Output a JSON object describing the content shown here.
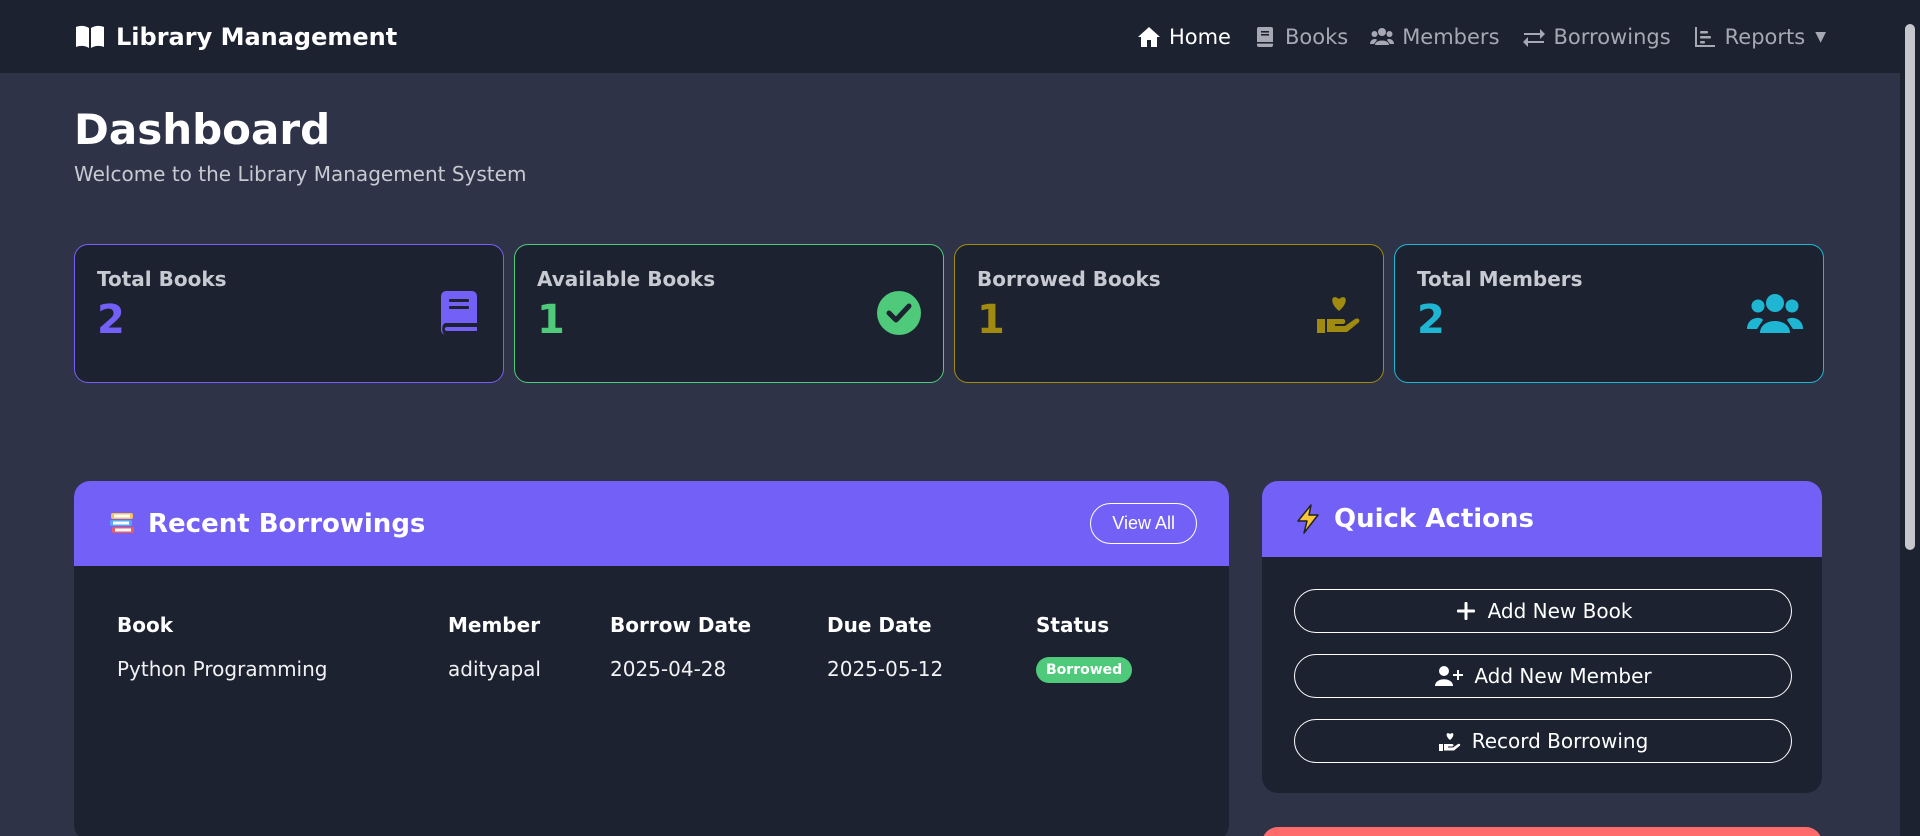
{
  "navbar": {
    "brand": "Library Management",
    "items": [
      {
        "label": "Home",
        "icon": "home-icon",
        "active": true
      },
      {
        "label": "Books",
        "icon": "book-icon",
        "active": false
      },
      {
        "label": "Members",
        "icon": "users-icon",
        "active": false
      },
      {
        "label": "Borrowings",
        "icon": "exchange-icon",
        "active": false
      },
      {
        "label": "Reports",
        "icon": "chart-icon",
        "active": false
      }
    ]
  },
  "header": {
    "title": "Dashboard",
    "subtitle": "Welcome to the Library Management System"
  },
  "stats": [
    {
      "label": "Total Books",
      "value": "2",
      "color": "#7360f6",
      "icon": "book-icon"
    },
    {
      "label": "Available Books",
      "value": "1",
      "color": "#4fc97a",
      "icon": "check-circle-icon"
    },
    {
      "label": "Borrowed Books",
      "value": "1",
      "color": "#a08b10",
      "icon": "hand-heart-icon"
    },
    {
      "label": "Total Members",
      "value": "2",
      "color": "#1fb6d4",
      "icon": "users-icon"
    }
  ],
  "recent": {
    "title": "Recent Borrowings",
    "view_all": "View All",
    "columns": [
      "Book",
      "Member",
      "Borrow Date",
      "Due Date",
      "Status"
    ],
    "rows": [
      {
        "book": "Python Programming",
        "member": "adityapal",
        "borrow_date": "2025-04-28",
        "due_date": "2025-05-12",
        "status": "Borrowed"
      }
    ]
  },
  "quick_actions": {
    "title": "Quick Actions",
    "buttons": [
      {
        "label": "Add New Book",
        "icon": "plus-icon"
      },
      {
        "label": "Add New Member",
        "icon": "user-plus-icon"
      },
      {
        "label": "Record Borrowing",
        "icon": "hand-holding-icon"
      }
    ]
  },
  "colors": {
    "accent": "#7360f6",
    "background": "#2e3347",
    "card": "#1d2230",
    "success": "#4fc97a",
    "warning": "#a08b10",
    "info": "#1fb6d4",
    "danger": "#ff6b6b"
  }
}
